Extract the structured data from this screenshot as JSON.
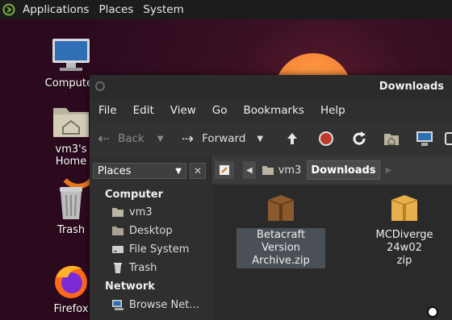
{
  "topbar": {
    "menu": [
      "Applications",
      "Places",
      "System"
    ]
  },
  "desktop": {
    "icons": [
      {
        "label": "Computer",
        "icon": "computer-icon"
      },
      {
        "label": "vm3's Home",
        "icon": "home-folder-icon"
      },
      {
        "label": "Trash",
        "icon": "trash-icon"
      },
      {
        "label": "Firefox",
        "icon": "firefox-icon"
      }
    ]
  },
  "window": {
    "title": "Downloads",
    "menu": [
      "File",
      "Edit",
      "View",
      "Go",
      "Bookmarks",
      "Help"
    ],
    "toolbar": {
      "back": "Back",
      "forward": "Forward"
    },
    "sidebar": {
      "selector": "Places",
      "sections": [
        {
          "title": "Computer",
          "items": [
            "vm3",
            "Desktop",
            "File System",
            "Trash"
          ]
        },
        {
          "title": "Network",
          "items": [
            "Browse Net…"
          ]
        }
      ]
    },
    "path": [
      "vm3",
      "Downloads"
    ],
    "files": [
      {
        "name_line1": "Betacraft Version",
        "name_line2": "Archive.zip"
      },
      {
        "name_line1": "MCDiverge 24w02",
        "name_line2": "zip"
      }
    ]
  },
  "colors": {
    "accent": "#f07a2e",
    "stop": "#c0392b",
    "folder": "#e8b04a"
  }
}
